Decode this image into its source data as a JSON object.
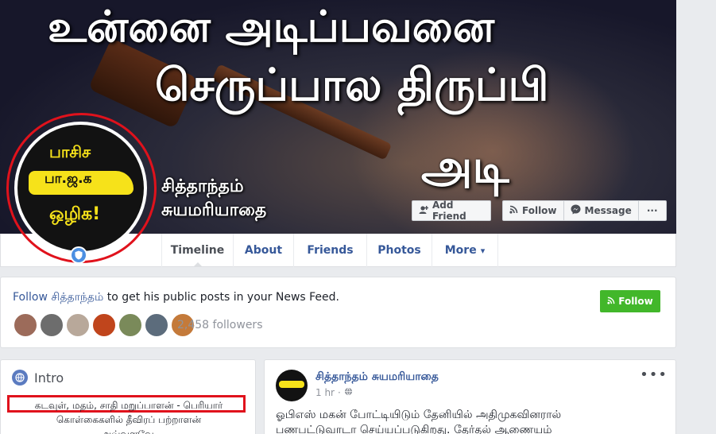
{
  "cover": {
    "line1": "உன்னை அடிப்பவனை",
    "line2": "செருப்பால திருப்பி",
    "line3": "அடி"
  },
  "profile": {
    "name_line1": "சித்தாந்தம்",
    "name_line2": "சுயமரியாதை",
    "avatar_text_top": "பாசிச",
    "avatar_text_mid": "பா.ஜ.க",
    "avatar_text_bottom": "ஒழிக!"
  },
  "actions": {
    "add_friend": "Add Friend",
    "follow": "Follow",
    "message": "Message",
    "more_dots": "···"
  },
  "nav": {
    "tabs": [
      "Timeline",
      "About",
      "Friends",
      "Photos",
      "More"
    ],
    "more_caret": "▾"
  },
  "follow_card": {
    "prefix": "Follow ",
    "name": "சித்தாந்தம்",
    "suffix": " to get his public posts in your News Feed.",
    "button": "Follow",
    "followers": "2,458 followers",
    "avatar_colors": [
      "#9c6b5a",
      "#6d6d6d",
      "#b8a89a",
      "#c0451c",
      "#7a8a5a",
      "#5c6c7c",
      "#c47a3a"
    ]
  },
  "intro": {
    "title": "Intro",
    "line1": "கடவுள், மதம், சாதி மறுப்பாளன் - பெரியார்",
    "line2": "கொள்கைகளில் தீவிரப் பற்றாளன்",
    "line3": "அவ்வளவே."
  },
  "post": {
    "author": "சித்தாந்தம் சுயமரியாதை",
    "time": "1 hr",
    "dot": "·",
    "menu": "•••",
    "text_line1": "ஓபிஎஸ் மகன் போட்டியிடும் தேனியில் அதிமுகவினரால்",
    "text_line2": "பணபட்டுவாடா செய்யப்படுகிறது. தேர்தல் ஆணையம்"
  },
  "colors": {
    "fb_blue": "#365899",
    "follow_green": "#42b72a",
    "highlight_red": "#e0121c"
  }
}
